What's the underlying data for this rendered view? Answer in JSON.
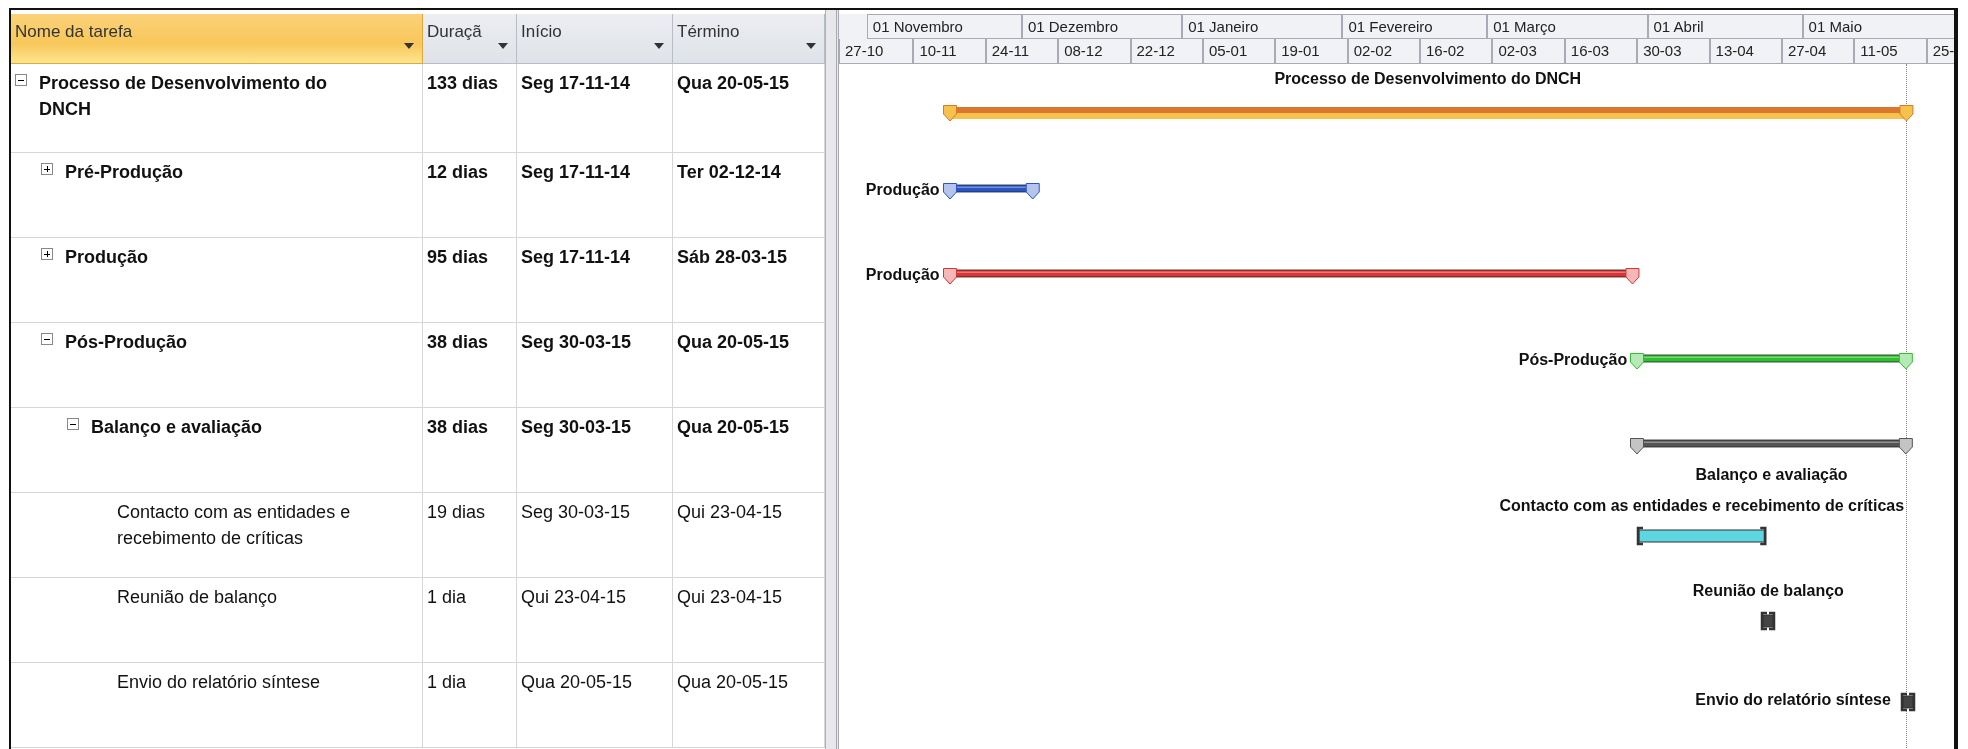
{
  "table": {
    "columns": [
      {
        "label": "Nome da tarefa",
        "selected": true
      },
      {
        "label": "Duraçã",
        "selected": false
      },
      {
        "label": "Início",
        "selected": false
      },
      {
        "label": "Término",
        "selected": false
      }
    ]
  },
  "timescale": {
    "months": [
      "01 Novembro",
      "01 Dezembro",
      "01 Janeiro",
      "01 Fevereiro",
      "01 Março",
      "01 Abril",
      "01 Maio"
    ],
    "weeks": [
      "27-10",
      "10-11",
      "24-11",
      "08-12",
      "22-12",
      "05-01",
      "19-01",
      "02-02",
      "16-02",
      "02-03",
      "16-03",
      "30-03",
      "13-04",
      "27-04",
      "11-05",
      "25-"
    ]
  },
  "tasks": [
    {
      "name": "Processo de Desenvolvimento do DNCH",
      "duration": "133 dias",
      "start": "Seg 17-11-14",
      "finish": "Qua 20-05-15",
      "kind": "summary",
      "expanded": true,
      "bar": {
        "kind": "project",
        "color": "#d9782d",
        "label": {
          "text": "Processo de Desenvolvimento do DNCH",
          "kind": "above"
        }
      },
      "children": [
        {
          "name": "Pré-Produção",
          "duration": "12 dias",
          "start": "Seg 17-11-14",
          "finish": "Ter 02-12-14",
          "kind": "summary",
          "expanded": false,
          "bar": {
            "kind": "summary",
            "color": "#2a55c8",
            "label": {
              "text": "Produção",
              "kind": "left"
            }
          }
        },
        {
          "name": "Produção",
          "duration": "95 dias",
          "start": "Seg 17-11-14",
          "finish": "Sáb 28-03-15",
          "kind": "summary",
          "expanded": false,
          "bar": {
            "kind": "summary",
            "color": "#dd3333",
            "label": {
              "text": "Produção",
              "kind": "left"
            }
          }
        },
        {
          "name": "Pós-Produção",
          "duration": "38 dias",
          "start": "Seg 30-03-15",
          "finish": "Qua 20-05-15",
          "kind": "summary",
          "expanded": true,
          "bar": {
            "kind": "summary",
            "color": "#2ec02e",
            "label": {
              "text": "Pós-Produção",
              "kind": "left"
            }
          },
          "children": [
            {
              "name": "Balanço e avaliação",
              "duration": "38 dias",
              "start": "Seg 30-03-15",
              "finish": "Qua 20-05-15",
              "kind": "summary",
              "expanded": true,
              "bar": {
                "kind": "summary",
                "color": "#555555",
                "label": {
                  "text": "Balanço e avaliação",
                  "kind": "below"
                }
              },
              "children": [
                {
                  "name": "Contacto com as entidades e recebimento de críticas",
                  "duration": "19 dias",
                  "start": "Seg 30-03-15",
                  "finish": "Qui 23-04-15",
                  "kind": "task",
                  "bar": {
                    "kind": "task",
                    "color": "#5ed6df",
                    "label": {
                      "text": "Contacto com as entidades e recebimento de críticas",
                      "kind": "above"
                    }
                  }
                },
                {
                  "name": "Reunião de balanço",
                  "duration": "1 dia",
                  "start": "Qui 23-04-15",
                  "finish": "Qui 23-04-15",
                  "kind": "task",
                  "bar": {
                    "kind": "task",
                    "color": "#444444",
                    "label": {
                      "text": "Reunião de balanço",
                      "kind": "above"
                    }
                  }
                },
                {
                  "name": "Envio do relatório síntese",
                  "duration": "1 dia",
                  "start": "Qua 20-05-15",
                  "finish": "Qua 20-05-15",
                  "kind": "task",
                  "bar": {
                    "kind": "task",
                    "color": "#444444",
                    "label": {
                      "text": "Envio do relatório síntese",
                      "kind": "left"
                    }
                  }
                }
              ]
            }
          ]
        }
      ]
    }
  ]
}
